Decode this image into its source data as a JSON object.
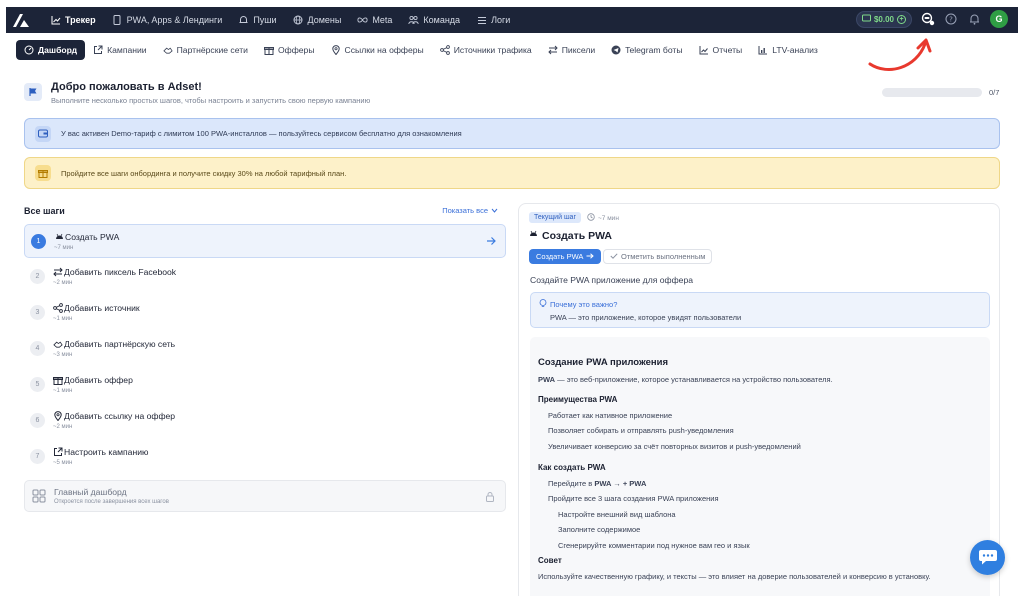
{
  "topnav": {
    "items": [
      {
        "label": "Трекер",
        "icon": "chart-line-icon",
        "active": true
      },
      {
        "label": "PWA, Apps & Лендинги",
        "icon": "phone-icon",
        "active": false
      },
      {
        "label": "Пуши",
        "icon": "bell-icon",
        "active": false
      },
      {
        "label": "Домены",
        "icon": "globe-icon",
        "active": false
      },
      {
        "label": "Meta",
        "icon": "infinity-icon",
        "active": false
      },
      {
        "label": "Команда",
        "icon": "team-icon",
        "active": false
      },
      {
        "label": "Логи",
        "icon": "list-icon",
        "active": false
      }
    ],
    "balance": "$0.00",
    "avatar": "G"
  },
  "subnav": {
    "items": [
      {
        "label": "Дашборд",
        "icon": "dashboard-icon",
        "active": true
      },
      {
        "label": "Кампании",
        "icon": "external-link-icon",
        "active": false
      },
      {
        "label": "Партнёрские сети",
        "icon": "handshake-icon",
        "active": false
      },
      {
        "label": "Офферы",
        "icon": "gift-icon",
        "active": false
      },
      {
        "label": "Ссылки на офферы",
        "icon": "pin-icon",
        "active": false
      },
      {
        "label": "Источники трафика",
        "icon": "share-icon",
        "active": false
      },
      {
        "label": "Пиксели",
        "icon": "swap-icon",
        "active": false
      },
      {
        "label": "Telegram боты",
        "icon": "telegram-icon",
        "active": false
      },
      {
        "label": "Отчеты",
        "icon": "report-icon",
        "active": false
      },
      {
        "label": "LTV-анализ",
        "icon": "bar-chart-icon",
        "active": false
      }
    ]
  },
  "welcome": {
    "title": "Добро пожаловать в Adset!",
    "subtitle": "Выполните несколько простых шагов, чтобы настроить и запустить свою первую кампанию",
    "progress_fraction": 0,
    "progress_label": "0/7"
  },
  "banners": {
    "demo": "У вас активен Demo-тариф с лимитом 100 PWA-инсталлов — пользуйтесь сервисом бесплатно для ознакомления",
    "discount": "Пройдите все шаги онбординга и получите скидку 30% на любой тарифный план."
  },
  "steps": {
    "title": "Все шаги",
    "show_all": "Показать все",
    "items": [
      {
        "num": "1",
        "label": "Создать PWA",
        "time": "~7 мин",
        "icon": "android-icon",
        "current": true
      },
      {
        "num": "2",
        "label": "Добавить пиксель Facebook",
        "time": "~2 мин",
        "icon": "swap-icon",
        "current": false
      },
      {
        "num": "3",
        "label": "Добавить источник",
        "time": "~1 мин",
        "icon": "share-icon",
        "current": false
      },
      {
        "num": "4",
        "label": "Добавить партнёрскую сеть",
        "time": "~3 мин",
        "icon": "handshake-icon",
        "current": false
      },
      {
        "num": "5",
        "label": "Добавить оффер",
        "time": "~1 мин",
        "icon": "gift-icon",
        "current": false
      },
      {
        "num": "6",
        "label": "Добавить ссылку на оффер",
        "time": "~2 мин",
        "icon": "pin-icon",
        "current": false
      },
      {
        "num": "7",
        "label": "Настроить кампанию",
        "time": "~5 мин",
        "icon": "external-link-icon",
        "current": false
      }
    ],
    "locked": {
      "label": "Главный дашборд",
      "hint": "Откроется после завершения всех шагов"
    }
  },
  "panel": {
    "badge": "Текущий шаг",
    "time": "~7 мин",
    "title": "Создать PWA",
    "primary_button": "Создать PWA",
    "secondary_button": "Отметить выполненным",
    "subtitle": "Создайте PWA приложение для оффера",
    "why_question": "Почему это важно?",
    "why_answer": "PWA — это приложение, которое увидят пользователи",
    "doc": {
      "h1": "Создание PWA приложения",
      "intro_bold": "PWA",
      "intro_rest": " — это веб-приложение, которое устанавливается на устройство пользователя.",
      "adv_title": "Преимущества PWA",
      "adv": [
        "Работает как нативное приложение",
        "Позволяет собирать и отправлять push-уведомления",
        "Увеличивает конверсию за счёт повторных визитов и push-уведомлений"
      ],
      "how_title": "Как создать PWA",
      "how_1_pre": "Перейдите в ",
      "how_1_bold": "PWA → + PWA",
      "how_2": "Пройдите все 3 шага создания PWA приложения",
      "how_sub": [
        "Настройте внешний вид шаблона",
        "Заполните содержимое",
        "Сгенерируйте комментарии под нужное вам гео и язык"
      ],
      "tip_title": "Совет",
      "tip": "Используйте качественную графику, и тексты — это влияет на доверие пользователей и конверсию в установку."
    }
  },
  "colors": {
    "nav_bg": "#1c2438",
    "accent": "#3a7be0",
    "balance_green": "#7fd98a",
    "annotation_red": "#e8392e"
  }
}
